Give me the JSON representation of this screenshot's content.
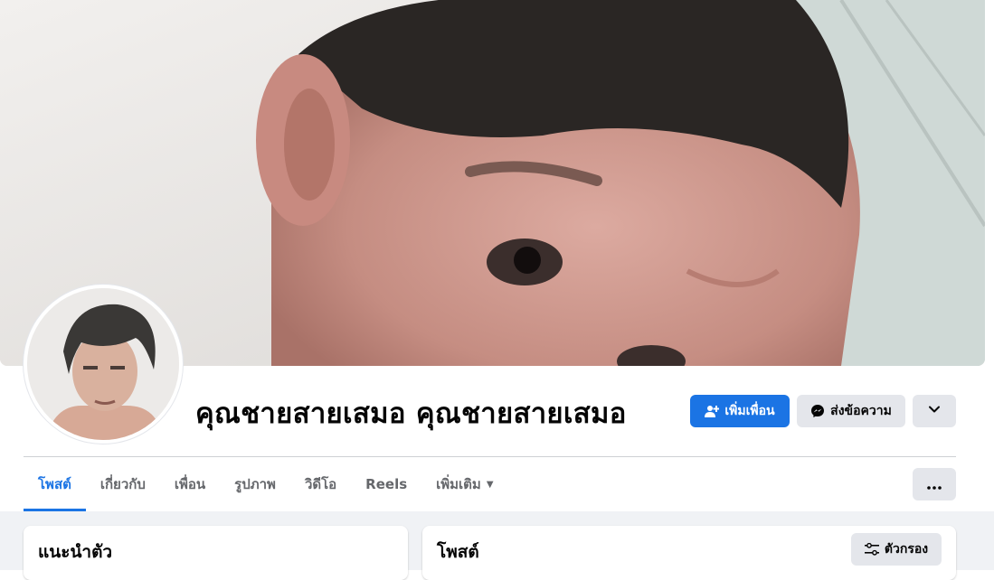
{
  "profile": {
    "name": "คุณชายสายเสมอ คุณชายสายเสมอ"
  },
  "actions": {
    "add_friend_label": "เพิ่มเพื่อน",
    "message_label": "ส่งข้อความ"
  },
  "tabs": [
    {
      "label": "โพสต์",
      "active": true
    },
    {
      "label": "เกี่ยวกับ",
      "active": false
    },
    {
      "label": "เพื่อน",
      "active": false
    },
    {
      "label": "รูปภาพ",
      "active": false
    },
    {
      "label": "วิดีโอ",
      "active": false
    },
    {
      "label": "Reels",
      "active": false
    },
    {
      "label": "เพิ่มเติม",
      "active": false
    }
  ],
  "intro_card": {
    "title": "แนะนำตัว"
  },
  "posts_card": {
    "title": "โพสต์",
    "filter_label": "ตัวกรอง"
  },
  "icons": {
    "add_friend": "person-plus-icon",
    "message": "messenger-icon",
    "expand": "chevron-down-icon",
    "more": "more-dots-icon",
    "tab_more": "caret-down-icon",
    "filter": "sliders-icon"
  },
  "colors": {
    "accent": "#1b74e4",
    "secondary_button": "#e4e6eb",
    "muted_text": "#65676b",
    "feed_background": "#f0f2f5"
  }
}
